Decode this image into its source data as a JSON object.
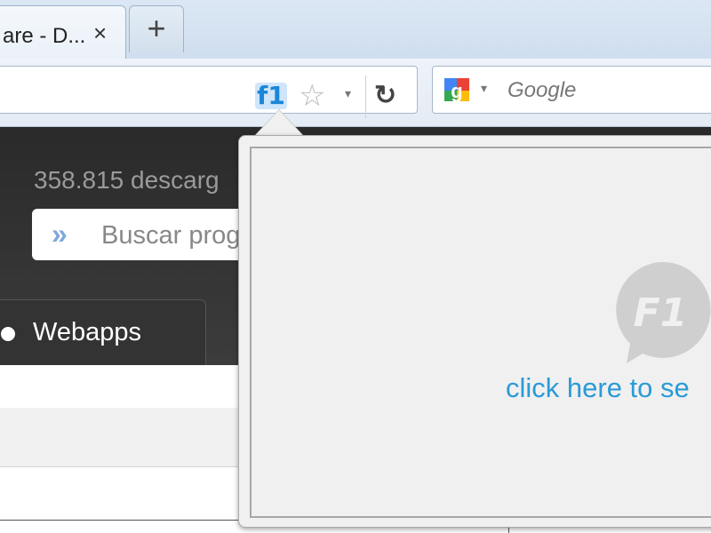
{
  "browser": {
    "tab": {
      "title": "are - D...",
      "close_label": "×"
    },
    "new_tab_label": "+",
    "toolbar": {
      "f1_label": "f1",
      "star_icon": "star-icon",
      "dropdown_glyph": "▾",
      "reload_glyph": "↻"
    },
    "search": {
      "engine": "Google",
      "placeholder": "Google",
      "dropdown_glyph": "▾"
    }
  },
  "page": {
    "download_count": "358.815 descarg",
    "search_placeholder": "Buscar prog",
    "search_chevron": "»",
    "nav_tab_label": "Webapps"
  },
  "popup": {
    "logo_text": "F1",
    "link_text": "click here to se"
  },
  "colors": {
    "accent_blue": "#2a9bd6",
    "f1_blue": "#1a86d6",
    "header_dark": "#2a2a2a",
    "popup_bg": "#f0f0f0"
  }
}
